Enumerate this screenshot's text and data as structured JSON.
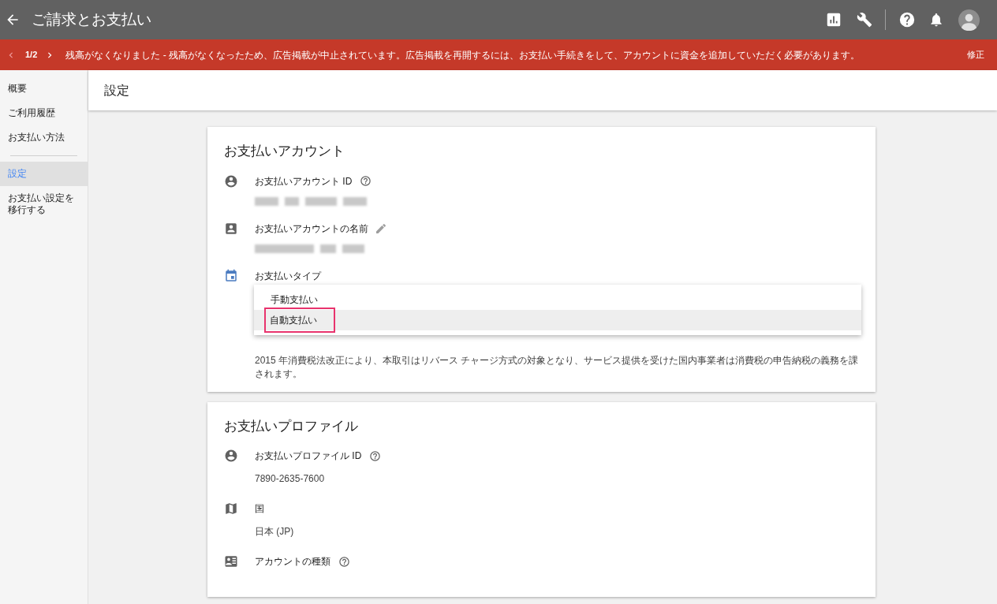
{
  "app_bar": {
    "title": "ご請求とお支払い"
  },
  "banner": {
    "pager": "1/2",
    "message": "残高がなくなりました - 残高がなくなったため、広告掲載が中止されています。広告掲載を再開するには、お支払い手続きをして、アカウントに資金を追加していただく必要があります。",
    "action": "修正"
  },
  "sidebar": {
    "items": [
      {
        "label": "概要",
        "selected": false
      },
      {
        "label": "ご利用履歴",
        "selected": false
      },
      {
        "label": "お支払い方法",
        "selected": false,
        "divider_after": true
      },
      {
        "label": "設定",
        "selected": true
      },
      {
        "label": "お支払い設定を移行する",
        "selected": false
      }
    ]
  },
  "page_title": "設定",
  "cards": [
    {
      "title": "お支払いアカウント",
      "fields": [
        {
          "label": "お支払いアカウント ID",
          "help": true,
          "redacted": true
        },
        {
          "label": "お支払いアカウントの名前",
          "editable": true,
          "redacted": true
        },
        {
          "label": "お支払いタイプ",
          "dropdown": [
            {
              "label": "手動支払い",
              "selected": false
            },
            {
              "label": "自動支払い",
              "selected": true
            }
          ]
        }
      ],
      "note": "2015 年消費税法改正により、本取引はリバース チャージ方式の対象となり、サービス提供を受けた国内事業者は消費税の申告納税の義務を課されます。"
    },
    {
      "title": "お支払いプロファイル",
      "fields": [
        {
          "label": "お支払いプロファイル ID",
          "help": true,
          "value": "7890-2635-7600"
        },
        {
          "label": "国",
          "value": "日本 (JP)"
        },
        {
          "label": "アカウントの種類",
          "help": true
        }
      ]
    }
  ]
}
